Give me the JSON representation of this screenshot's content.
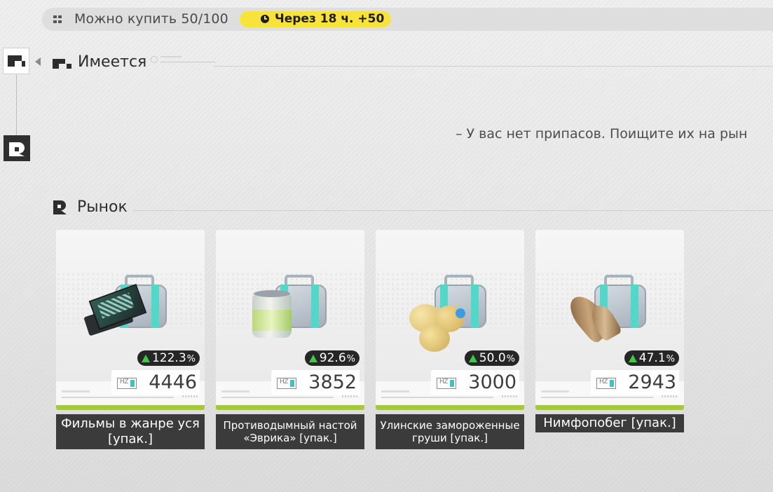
{
  "topbar": {
    "purchase_label": "Можно купить 50/100",
    "timer_label": "Через 18 ч. +50",
    "timer_color": "#f8e33c"
  },
  "sections": {
    "owned_title": "Имеется",
    "owned_empty_message": "– У вас нет припасов. Поищите их на рын",
    "market_title": "Рынок"
  },
  "market": {
    "items": [
      {
        "name": "Фильмы в жанре уся [упак.]",
        "change": "122.3",
        "percent_sign": "%",
        "price": "4446",
        "art": "film-tapes"
      },
      {
        "name": "Противодымный настой «Эврика» [упак.]",
        "change": "92.6",
        "percent_sign": "%",
        "price": "3852",
        "art": "tea-can"
      },
      {
        "name": "Улинские замороженные груши [упак.]",
        "change": "50.0",
        "percent_sign": "%",
        "price": "3000",
        "art": "frozen-pears"
      },
      {
        "name": "Нимфопобег [упак.]",
        "change": "47.1",
        "percent_sign": "%",
        "price": "2943",
        "art": "bamboo-shoot"
      }
    ],
    "up_color": "#43c74a",
    "bar_color": "#a5c93c",
    "currency_icon": "hz-currency-icon"
  }
}
